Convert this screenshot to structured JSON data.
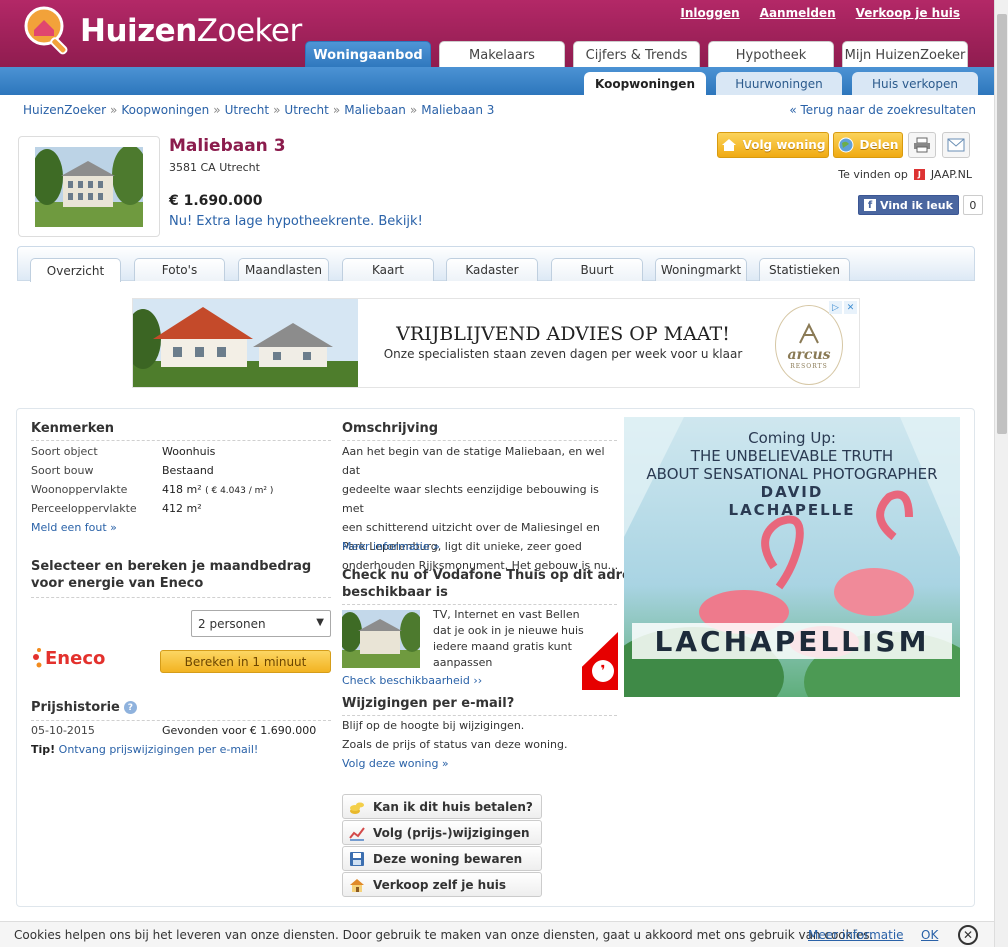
{
  "header": {
    "logo_part1": "Huizen",
    "logo_part2": "Zoeker",
    "links": {
      "login": "Inloggen",
      "register": "Aanmelden",
      "sell": "Verkoop je huis"
    },
    "main_tabs": [
      "Woningaanbod",
      "Makelaars",
      "Cijfers & Trends",
      "Hypotheek",
      "Mijn HuizenZoeker"
    ],
    "sub_tabs": [
      "Koopwoningen",
      "Huurwoningen",
      "Huis verkopen"
    ]
  },
  "breadcrumb": {
    "items": [
      "HuizenZoeker",
      "Koopwoningen",
      "Utrecht",
      "Utrecht",
      "Maliebaan",
      "Maliebaan 3"
    ],
    "separator": "»",
    "back": "« Terug naar de zoekresultaten"
  },
  "property": {
    "title": "Maliebaan 3",
    "zip": "3581 CA Utrecht",
    "price": "€ 1.690.000",
    "mortgage_link": "Nu! Extra lage hypotheekrente. Bekijk!"
  },
  "actions": {
    "follow": "Volg woning",
    "share": "Delen",
    "find_on": "Te vinden op",
    "jaap": "JAAP.NL",
    "fb_like": "Vind ik leuk",
    "fb_count": "0"
  },
  "detail_tabs": [
    "Overzicht",
    "Foto's",
    "Maandlasten",
    "Kaart",
    "Kadaster",
    "Buurt",
    "Woningmarkt",
    "Statistieken"
  ],
  "banner": {
    "headline": "VRIJBLIJVEND ADVIES OP MAAT!",
    "sub": "Onze specialisten staan zeven dagen per week voor u klaar",
    "brand": "arcus",
    "brand_sub": "RESORTS"
  },
  "kenmerken": {
    "title": "Kenmerken",
    "rows": [
      {
        "label": "Soort object",
        "value": "Woonhuis"
      },
      {
        "label": "Soort bouw",
        "value": "Bestaand"
      },
      {
        "label": "Woonoppervlakte",
        "value": "418 m²",
        "extra": "( € 4.043 / m² )"
      },
      {
        "label": "Perceeloppervlakte",
        "value": "412 m²"
      }
    ],
    "report": "Meld een fout »"
  },
  "energy": {
    "title_line1": "Selecteer en bereken je maandbedrag",
    "title_line2": "voor energie van Eneco",
    "select_value": "2 personen",
    "brand": "Eneco",
    "button": "Bereken in 1 minuut"
  },
  "pricehistory": {
    "title": "Prijshistorie",
    "date": "05-10-2015",
    "event": "Gevonden voor € 1.690.000",
    "tip_label": "Tip!",
    "tip_link": "Ontvang prijswijzigingen per e-mail!"
  },
  "description": {
    "title": "Omschrijving",
    "lines": [
      "Aan het begin van de statige Maliebaan, en wel dat",
      "gedeelte waar slechts eenzijdige bebouwing is met",
      "een schitterend uitzicht over de Maliesingel en",
      "Park Lepelenburg, ligt dit unieke, zeer goed",
      "onderhouden Rijksmonument. Het gebouw is nu..."
    ],
    "more": "Meer informatie »"
  },
  "vodafone": {
    "title_line1": "Check nu of Vodafone Thuis op dit adres",
    "title_line2": "beschikbaar is",
    "lines": [
      "TV, Internet en vast Bellen",
      "dat je ook in je nieuwe huis",
      "iedere maand gratis kunt",
      "aanpassen"
    ],
    "check": "Check beschikbaarheid ››"
  },
  "emailchanges": {
    "title": "Wijzigingen per e-mail?",
    "line1": "Blijf op de hoogte bij wijzigingen.",
    "line2": "Zoals de prijs of status van deze woning.",
    "link": "Volg deze woning »"
  },
  "tools": [
    "Kan ik dit huis betalen?",
    "Volg (prijs-)wijzigingen",
    "Deze woning bewaren",
    "Verkoop zelf je huis"
  ],
  "sidead": {
    "line1": "Coming Up:",
    "line2": "THE UNBELIEVABLE TRUTH",
    "line3": "ABOUT SENSATIONAL PHOTOGRAPHER",
    "line4": "DAVID",
    "line5": "LACHAPELLE",
    "brand": "LACHAPELLISM"
  },
  "cookie": {
    "text": "Cookies helpen ons bij het leveren van onze diensten. Door gebruik te maken van onze diensten, gaat u akkoord met ons gebruik van cookies.",
    "more": "Meer informatie",
    "ok": "OK"
  },
  "colors": {
    "brand": "#a3235c",
    "blue": "#2e77bd",
    "link": "#2a62a8",
    "orange": "#f0aa12"
  }
}
